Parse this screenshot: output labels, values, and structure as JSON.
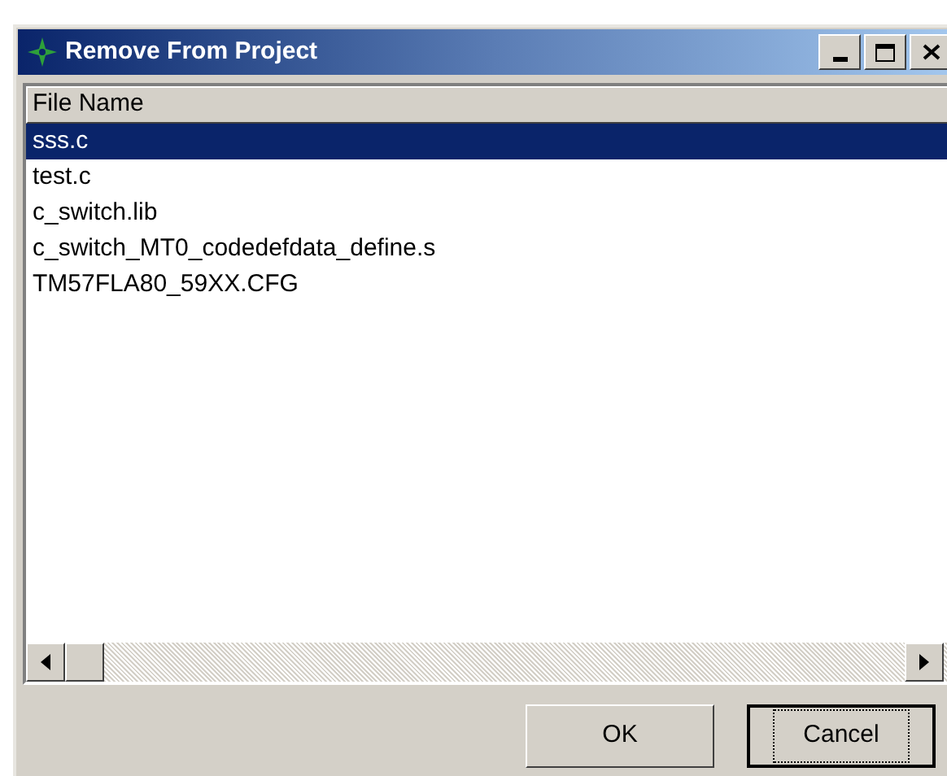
{
  "window": {
    "title": "Remove From Project"
  },
  "list": {
    "columns": [
      "File Name"
    ],
    "rows": [
      {
        "name": "sss.c",
        "selected": true
      },
      {
        "name": "test.c",
        "selected": false
      },
      {
        "name": "c_switch.lib",
        "selected": false
      },
      {
        "name": "c_switch_MT0_codedefdata_define.s",
        "selected": false
      },
      {
        "name": "TM57FLA80_59XX.CFG",
        "selected": false
      }
    ]
  },
  "buttons": [
    {
      "label": "OK",
      "focused": false
    },
    {
      "label": "Cancel",
      "focused": true
    }
  ]
}
